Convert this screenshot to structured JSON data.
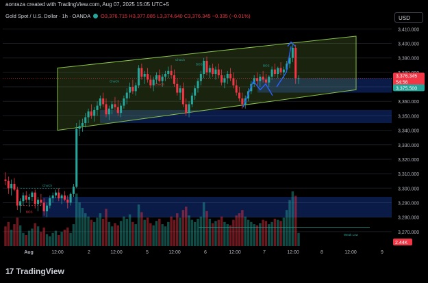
{
  "header": {
    "author_text": "aonraza created with TradingView.com, Aug 07, 2025 15:05 UTC+5"
  },
  "legend": {
    "symbol": "Gold Spot / U.S. Dollar · 1h · OANDA",
    "open": "O3,376.715",
    "high": "H3,377.085",
    "low": "L3,374.640",
    "close": "C3,376.345",
    "change": "−0.335 (−0.01%)"
  },
  "currency_button": "USD",
  "branding": {
    "logo_text": "TradingView",
    "logo_mark": "17"
  },
  "colors": {
    "up": "#26a69a",
    "down": "#f23645",
    "channel_fill": "#8bc34a",
    "zone_fill": "#2962ff",
    "arrow": "#2962ff"
  },
  "chart_data": {
    "type": "candlestick",
    "ylim": [
      3260,
      3413
    ],
    "yticks": [
      "3,270.000",
      "3,280.000",
      "3,290.000",
      "3,300.000",
      "3,310.000",
      "3,320.000",
      "3,330.000",
      "3,340.000",
      "3,350.000",
      "3,360.000",
      "3,370.000",
      "3,380.000",
      "3,390.000",
      "3,400.000",
      "3,410.000"
    ],
    "ytick_values": [
      3270,
      3280,
      3290,
      3300,
      3310,
      3320,
      3330,
      3340,
      3350,
      3360,
      3370,
      3380,
      3390,
      3400,
      3410
    ],
    "xticks": [
      "Aug",
      "12:00",
      "2",
      "12:00",
      "5",
      "12:00",
      "6",
      "12:00",
      "7",
      "12:00",
      "8",
      "12:00",
      "9"
    ],
    "price_labels": {
      "last": "3,376.345",
      "countdown": "54:56",
      "level": "3,375.500",
      "volume": "2.44K"
    },
    "annotations": [
      "ChoCh",
      "BOS",
      "ChoCh",
      "ChoCh",
      "ChoCh",
      "BOS",
      "BOS",
      "Weak Low"
    ],
    "zones": [
      {
        "name": "lower-demand-zone",
        "y_low": 3280,
        "y_high": 3294
      },
      {
        "name": "mid-demand-zone",
        "y_low": 3345,
        "y_high": 3354
      },
      {
        "name": "upper-demand-zone",
        "y_low": 3366,
        "y_high": 3376
      }
    ],
    "channel": {
      "start_top": 3383,
      "end_top": 3405,
      "start_bottom": 3340,
      "end_bottom": 3368
    },
    "candles": [
      [
        3306,
        3311,
        3302,
        3305
      ],
      [
        3305,
        3308,
        3296,
        3300
      ],
      [
        3300,
        3306,
        3295,
        3303
      ],
      [
        3303,
        3307,
        3298,
        3299
      ],
      [
        3299,
        3301,
        3285,
        3288
      ],
      [
        3288,
        3293,
        3283,
        3291
      ],
      [
        3291,
        3297,
        3288,
        3295
      ],
      [
        3295,
        3298,
        3290,
        3292
      ],
      [
        3292,
        3296,
        3287,
        3294
      ],
      [
        3294,
        3298,
        3291,
        3297
      ],
      [
        3297,
        3299,
        3286,
        3289
      ],
      [
        3289,
        3294,
        3284,
        3292
      ],
      [
        3292,
        3296,
        3288,
        3290
      ],
      [
        3290,
        3293,
        3281,
        3284
      ],
      [
        3284,
        3290,
        3280,
        3288
      ],
      [
        3288,
        3295,
        3286,
        3293
      ],
      [
        3293,
        3297,
        3290,
        3295
      ],
      [
        3295,
        3299,
        3293,
        3297
      ],
      [
        3297,
        3300,
        3291,
        3293
      ],
      [
        3293,
        3296,
        3289,
        3295
      ],
      [
        3295,
        3298,
        3291,
        3292
      ],
      [
        3292,
        3295,
        3286,
        3290
      ],
      [
        3290,
        3297,
        3288,
        3296
      ],
      [
        3296,
        3303,
        3294,
        3301
      ],
      [
        3301,
        3345,
        3300,
        3341
      ],
      [
        3341,
        3347,
        3336,
        3343
      ],
      [
        3343,
        3348,
        3339,
        3345
      ],
      [
        3345,
        3352,
        3342,
        3349
      ],
      [
        3349,
        3355,
        3345,
        3353
      ],
      [
        3353,
        3358,
        3348,
        3350
      ],
      [
        3350,
        3356,
        3346,
        3354
      ],
      [
        3354,
        3360,
        3350,
        3357
      ],
      [
        3357,
        3364,
        3355,
        3362
      ],
      [
        3362,
        3366,
        3356,
        3358
      ],
      [
        3358,
        3362,
        3349,
        3351
      ],
      [
        3351,
        3357,
        3347,
        3355
      ],
      [
        3355,
        3360,
        3351,
        3358
      ],
      [
        3358,
        3363,
        3354,
        3356
      ],
      [
        3356,
        3361,
        3350,
        3352
      ],
      [
        3352,
        3359,
        3349,
        3357
      ],
      [
        3357,
        3364,
        3355,
        3362
      ],
      [
        3362,
        3369,
        3358,
        3366
      ],
      [
        3366,
        3373,
        3362,
        3370
      ],
      [
        3370,
        3375,
        3365,
        3367
      ],
      [
        3367,
        3373,
        3364,
        3371
      ],
      [
        3371,
        3385,
        3369,
        3383
      ],
      [
        3383,
        3386,
        3375,
        3377
      ],
      [
        3377,
        3381,
        3372,
        3379
      ],
      [
        3379,
        3383,
        3373,
        3375
      ],
      [
        3375,
        3378,
        3369,
        3371
      ],
      [
        3371,
        3377,
        3367,
        3375
      ],
      [
        3375,
        3380,
        3372,
        3378
      ],
      [
        3378,
        3382,
        3373,
        3374
      ],
      [
        3374,
        3379,
        3370,
        3377
      ],
      [
        3377,
        3381,
        3374,
        3379
      ],
      [
        3379,
        3384,
        3376,
        3381
      ],
      [
        3381,
        3385,
        3376,
        3378
      ],
      [
        3378,
        3382,
        3370,
        3372
      ],
      [
        3372,
        3376,
        3364,
        3366
      ],
      [
        3366,
        3371,
        3361,
        3369
      ],
      [
        3369,
        3373,
        3356,
        3358
      ],
      [
        3358,
        3362,
        3350,
        3352
      ],
      [
        3352,
        3360,
        3349,
        3358
      ],
      [
        3358,
        3366,
        3356,
        3364
      ],
      [
        3364,
        3371,
        3361,
        3369
      ],
      [
        3369,
        3376,
        3366,
        3374
      ],
      [
        3374,
        3381,
        3371,
        3379
      ],
      [
        3379,
        3390,
        3376,
        3388
      ],
      [
        3388,
        3391,
        3378,
        3380
      ],
      [
        3380,
        3385,
        3376,
        3383
      ],
      [
        3383,
        3386,
        3377,
        3379
      ],
      [
        3379,
        3384,
        3375,
        3382
      ],
      [
        3382,
        3386,
        3376,
        3378
      ],
      [
        3378,
        3382,
        3371,
        3373
      ],
      [
        3373,
        3378,
        3369,
        3376
      ],
      [
        3376,
        3381,
        3372,
        3379
      ],
      [
        3379,
        3383,
        3374,
        3376
      ],
      [
        3376,
        3380,
        3369,
        3371
      ],
      [
        3371,
        3375,
        3364,
        3366
      ],
      [
        3366,
        3370,
        3360,
        3362
      ],
      [
        3362,
        3366,
        3355,
        3358
      ],
      [
        3358,
        3364,
        3355,
        3362
      ],
      [
        3362,
        3369,
        3360,
        3367
      ],
      [
        3367,
        3374,
        3365,
        3372
      ],
      [
        3372,
        3378,
        3370,
        3376
      ],
      [
        3376,
        3380,
        3371,
        3374
      ],
      [
        3374,
        3379,
        3370,
        3377
      ],
      [
        3377,
        3381,
        3373,
        3375
      ],
      [
        3375,
        3379,
        3371,
        3373
      ],
      [
        3373,
        3378,
        3370,
        3377
      ],
      [
        3377,
        3384,
        3375,
        3382
      ],
      [
        3382,
        3386,
        3377,
        3379
      ],
      [
        3379,
        3384,
        3376,
        3383
      ],
      [
        3383,
        3387,
        3378,
        3380
      ],
      [
        3380,
        3384,
        3376,
        3382
      ],
      [
        3382,
        3388,
        3380,
        3386
      ],
      [
        3386,
        3392,
        3383,
        3390
      ],
      [
        3390,
        3400,
        3387,
        3397
      ],
      [
        3397,
        3399,
        3372,
        3376
      ],
      [
        3376,
        3378,
        3372,
        3376
      ]
    ],
    "volumes": [
      18,
      22,
      15,
      20,
      26,
      19,
      12,
      10,
      14,
      16,
      21,
      18,
      13,
      17,
      11,
      9,
      12,
      14,
      10,
      13,
      15,
      17,
      12,
      20,
      48,
      40,
      35,
      30,
      27,
      24,
      22,
      26,
      30,
      25,
      34,
      22,
      18,
      21,
      19,
      23,
      27,
      25,
      29,
      22,
      20,
      38,
      31,
      24,
      26,
      21,
      19,
      23,
      25,
      20,
      18,
      22,
      27,
      24,
      30,
      26,
      33,
      36,
      28,
      24,
      22,
      25,
      27,
      40,
      32,
      25,
      21,
      23,
      24,
      27,
      22,
      20,
      19,
      24,
      28,
      30,
      33,
      27,
      24,
      22,
      20,
      19,
      21,
      24,
      23,
      20,
      22,
      25,
      24,
      23,
      26,
      33,
      42,
      50,
      46,
      12
    ]
  }
}
